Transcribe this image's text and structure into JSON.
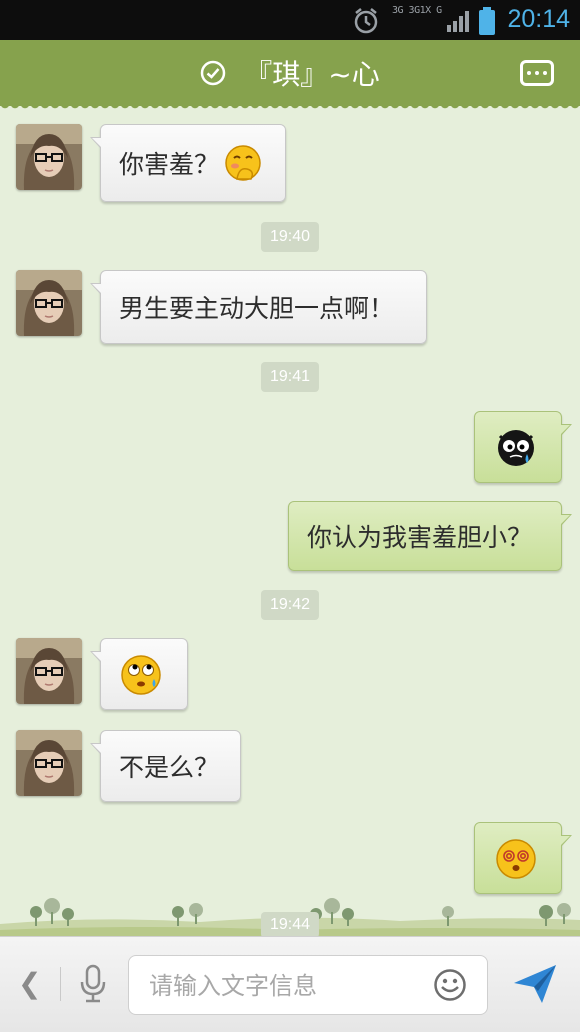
{
  "status_bar": {
    "network_label": "3G 3G1X G",
    "time": "20:14",
    "icons": [
      "alarm-clock-icon",
      "signal-bars-icon",
      "battery-icon"
    ]
  },
  "header": {
    "title": "『琪』~心",
    "left_icon": "check-circle-icon",
    "right_icon": "more-menu-icon"
  },
  "messages": [
    {
      "side": "left",
      "text": "你害羞？",
      "emoji": "shy-emoji"
    },
    {
      "type": "timestamp",
      "text": "19:40"
    },
    {
      "side": "left",
      "text": "男生要主动大胆一点啊！"
    },
    {
      "type": "timestamp",
      "text": "19:41"
    },
    {
      "side": "right",
      "emoji": "crying-black-face-emoji"
    },
    {
      "side": "right",
      "text": "你认为我害羞胆小？"
    },
    {
      "type": "timestamp",
      "text": "19:42"
    },
    {
      "side": "left",
      "emoji": "eye-roll-emoji"
    },
    {
      "side": "left",
      "text": "不是么？"
    },
    {
      "side": "right",
      "emoji": "dizzy-face-emoji"
    },
    {
      "type": "timestamp",
      "text": "19:44"
    }
  ],
  "input_bar": {
    "placeholder": "请输入文字信息",
    "value": "",
    "icons": [
      "back-chevron-icon",
      "microphone-icon",
      "smiley-icon",
      "send-icon"
    ]
  },
  "colors": {
    "header_green": "#86a24d",
    "chat_background": "#e6efdb",
    "sent_bubble": "#c8df99",
    "time_blue": "#4fb3e8"
  }
}
